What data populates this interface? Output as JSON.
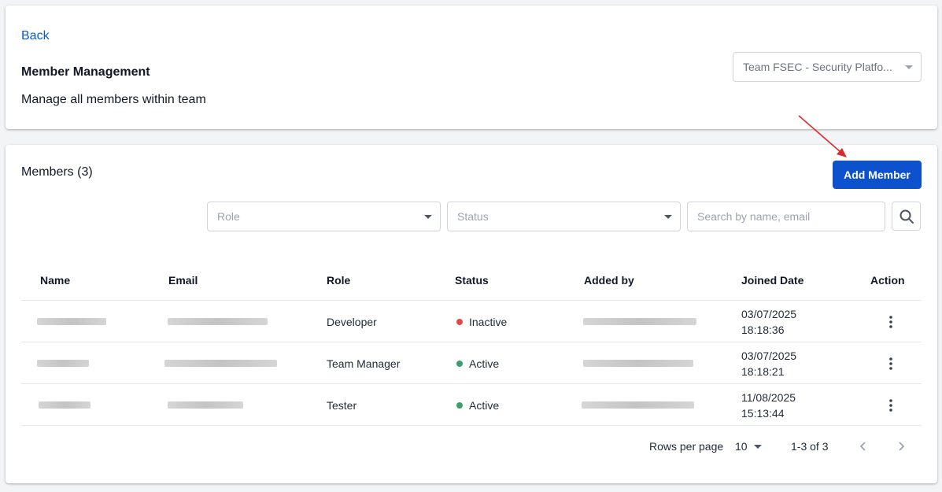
{
  "header": {
    "back_label": "Back",
    "title": "Member Management",
    "subtitle": "Manage all members within team",
    "team_select_value": "Team FSEC - Security Platfo..."
  },
  "members": {
    "title": "Members (3)",
    "add_button_label": "Add Member",
    "filters": {
      "role_placeholder": "Role",
      "status_placeholder": "Status",
      "search_placeholder": "Search by name, email"
    },
    "columns": [
      "Name",
      "Email",
      "Role",
      "Status",
      "Added by",
      "Joined Date",
      "Action"
    ],
    "rows": [
      {
        "role": "Developer",
        "status": "Inactive",
        "status_color": "#e04b4b",
        "joined_date": "03/07/2025",
        "joined_time": "18:18:36"
      },
      {
        "role": "Team Manager",
        "status": "Active",
        "status_color": "#3a9e6f",
        "joined_date": "03/07/2025",
        "joined_time": "18:18:21"
      },
      {
        "role": "Tester",
        "status": "Active",
        "status_color": "#3a9e6f",
        "joined_date": "11/08/2025",
        "joined_time": "15:13:44"
      }
    ],
    "pagination": {
      "rows_per_page_label": "Rows per page",
      "rows_per_page_value": "10",
      "range_text": "1-3 of 3"
    }
  },
  "colors": {
    "primary": "#0d52cc",
    "link": "#0a58ca",
    "active": "#3a9e6f",
    "inactive": "#e04b4b",
    "annotation_arrow": "#d92b2b"
  }
}
